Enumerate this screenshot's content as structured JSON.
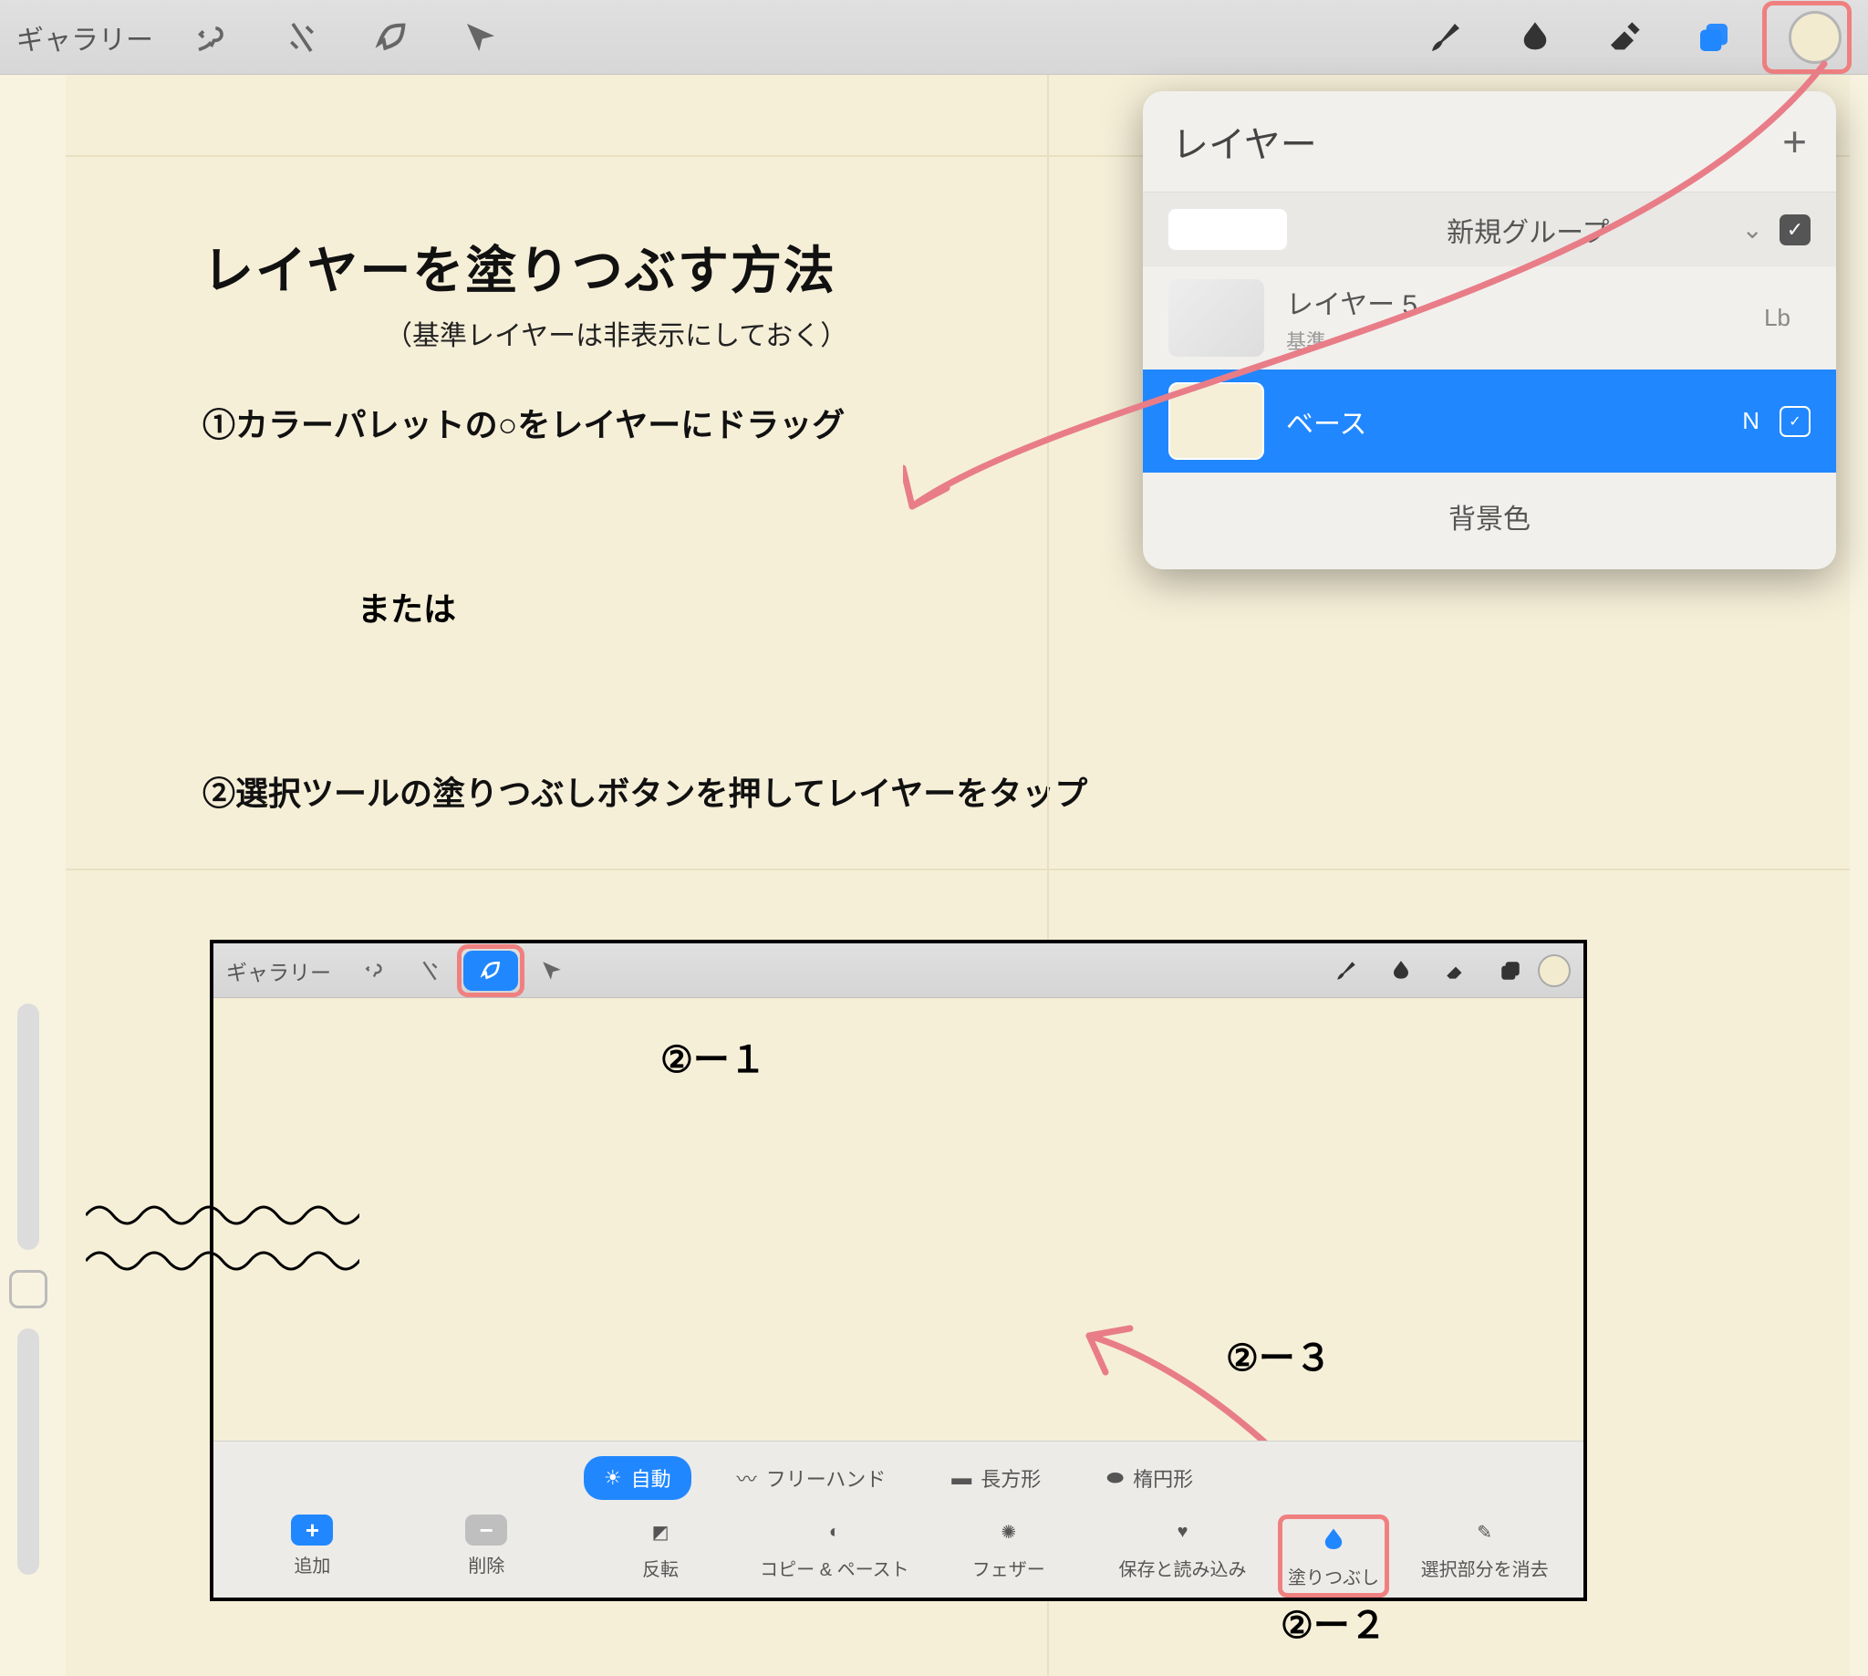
{
  "toolbar": {
    "gallery": "ギャラリー"
  },
  "layers": {
    "title": "レイヤー",
    "group": "新規グループ",
    "layer5": "レイヤー 5",
    "base": "基準",
    "selected": "ベース",
    "blend_lb": "Lb",
    "blend_n": "N",
    "bg": "背景色"
  },
  "note": {
    "title": "レイヤーを塗りつぶす方法",
    "sub": "（基準レイヤーは非表示にしておく）",
    "step1": "①カラーパレットの○をレイヤーにドラッグ",
    "or": "または",
    "step2": "②選択ツールの塗りつぶしボタンを押してレイヤーをタップ",
    "a21": "②ー１",
    "a22": "②ー２",
    "a23": "②ー３"
  },
  "embed": {
    "gallery": "ギャラリー"
  },
  "selbar": {
    "auto": "自動",
    "freehand": "フリーハンド",
    "rect": "長方形",
    "ellipse": "楕円形",
    "add": "追加",
    "remove": "削除",
    "invert": "反転",
    "copypaste": "コピー & ペースト",
    "feather": "フェザー",
    "saveload": "保存と読み込み",
    "fill": "塗りつぶし",
    "clear": "選択部分を消去"
  }
}
